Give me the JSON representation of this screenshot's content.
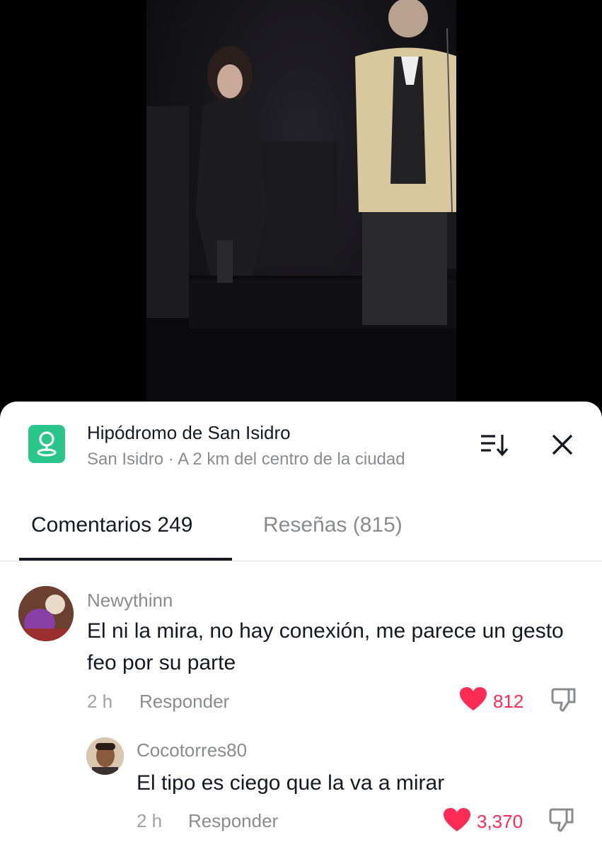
{
  "location": {
    "title": "Hipódromo de San Isidro",
    "subtitle": "San Isidro · A 2 km del centro de la ciudad"
  },
  "tabs": [
    {
      "label": "Comentarios 249",
      "active": true
    },
    {
      "label": "Reseñas (815)",
      "active": false
    }
  ],
  "comments": [
    {
      "username": "Newythinn",
      "text": "El ni la mira, no hay conexión, me parece un gesto feo por su parte",
      "time": "2 h",
      "reply_label": "Responder",
      "likes": "812"
    },
    {
      "username": "Cocotorres80",
      "text": "El tipo es ciego que la va a mirar",
      "time": "2 h",
      "reply_label": "Responder",
      "likes": "3,370"
    }
  ],
  "colors": {
    "accent_like": "#fe2c55",
    "location_icon_bg": "#2bc48a",
    "text_primary": "#161823",
    "text_secondary": "#8a8b91"
  },
  "icons": [
    "location-pin-icon",
    "sort-icon",
    "close-icon",
    "heart-icon",
    "dislike-icon"
  ]
}
